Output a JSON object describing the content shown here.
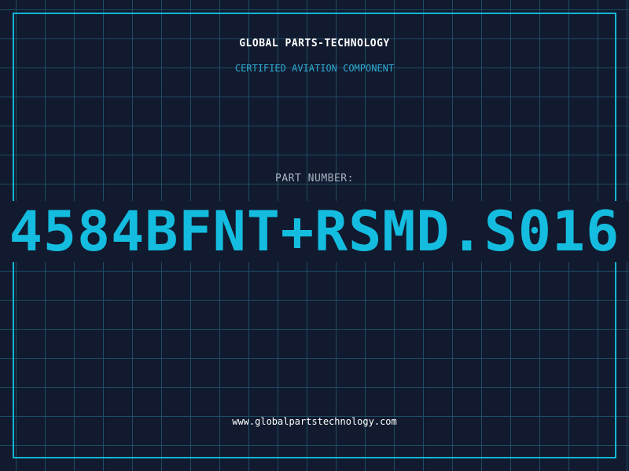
{
  "header": {
    "company": "GLOBAL PARTS-TECHNOLOGY",
    "tagline": "CERTIFIED AVIATION COMPONENT"
  },
  "part": {
    "label": "PART NUMBER:",
    "number": "4584BFNT+RSMD.S016"
  },
  "footer": {
    "website": "www.globalpartstechnology.com"
  },
  "colors": {
    "background": "#111a2e",
    "grid": "#1f4c64",
    "accent": "#13b6d6",
    "text": "#ffffff"
  }
}
